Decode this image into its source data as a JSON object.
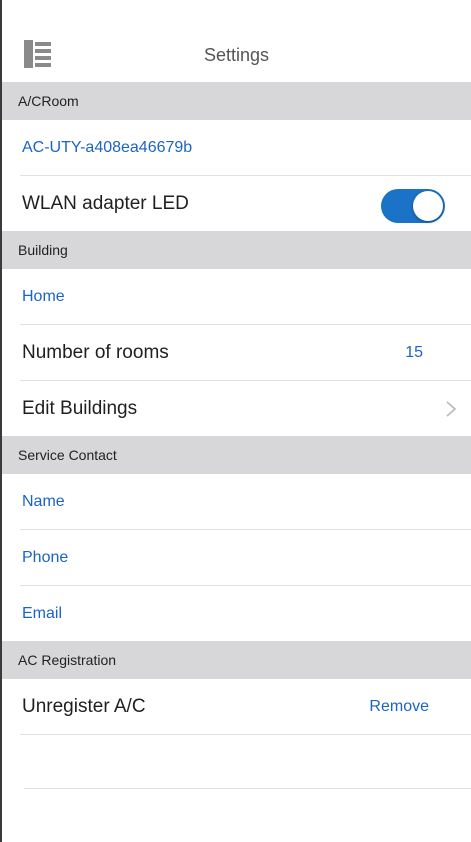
{
  "header": {
    "title": "Settings",
    "menu_icon": "hamburger-menu-icon"
  },
  "sections": {
    "ac_room": {
      "label": "A/CRoom"
    },
    "building": {
      "label": "Building"
    },
    "service_contact": {
      "label": "Service Contact"
    },
    "ac_registration": {
      "label": "AC Registration"
    }
  },
  "ac_room": {
    "device_id": "AC-UTY-a408ea46679b",
    "wlan_led_label": "WLAN adapter LED",
    "wlan_led_on": true
  },
  "building": {
    "name": "Home",
    "rooms_label": "Number of rooms",
    "rooms_value": "15",
    "edit_label": "Edit Buildings"
  },
  "service_contact": {
    "name_label": "Name",
    "phone_label": "Phone",
    "email_label": "Email"
  },
  "ac_registration": {
    "unregister_label": "Unregister A/C",
    "remove_label": "Remove"
  },
  "colors": {
    "accent": "#1b64c7",
    "toggle_on": "#1a73c7",
    "section_bg": "#d7d7d9"
  }
}
